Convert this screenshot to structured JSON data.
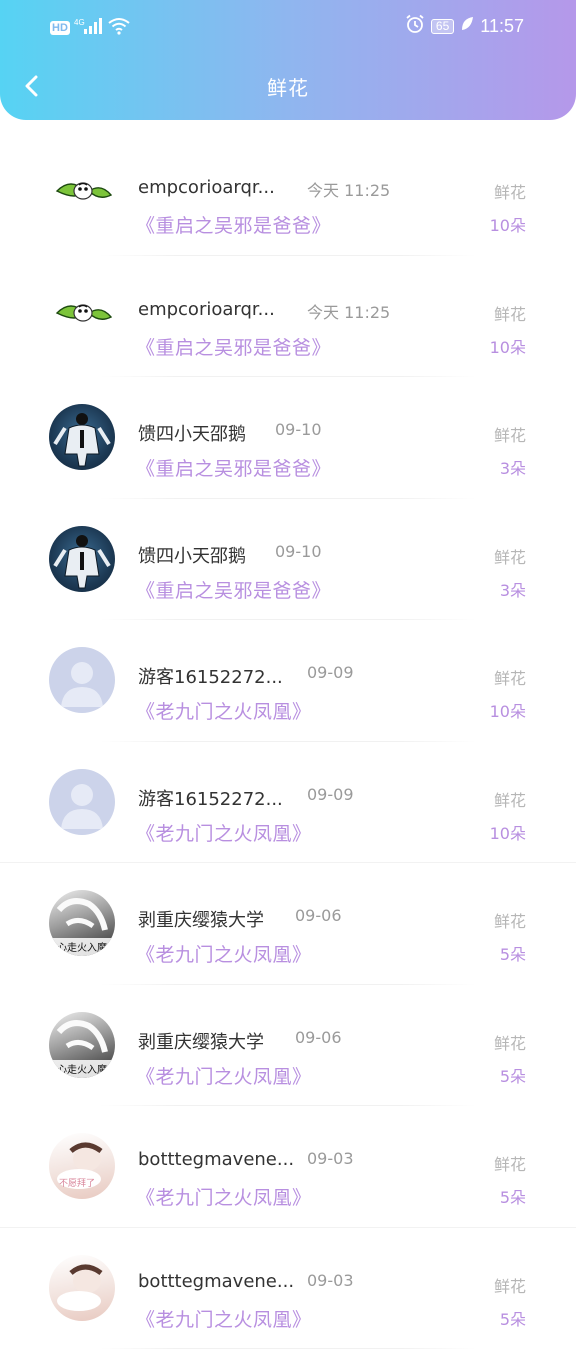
{
  "status_bar": {
    "hd": "HD",
    "network": "4G",
    "battery": "65",
    "time": "11:57"
  },
  "header": {
    "title": "鲜花"
  },
  "records": [
    {
      "avatar": "bird-avatar",
      "name": "empcorioarqr...",
      "time": "今天 11:25",
      "book": "《重启之吴邪是爸爸》",
      "gift": "鲜花",
      "count": "10朵"
    },
    {
      "avatar": "bird-avatar",
      "name": "empcorioarqr...",
      "time": "今天 11:25",
      "book": "《重启之吴邪是爸爸》",
      "gift": "鲜花",
      "count": "10朵"
    },
    {
      "avatar": "figure-avatar",
      "name": "馈四小天邵鹅",
      "time": "09-10",
      "book": "《重启之吴邪是爸爸》",
      "gift": "鲜花",
      "count": "3朵"
    },
    {
      "avatar": "figure-avatar",
      "name": "馈四小天邵鹅",
      "time": "09-10",
      "book": "《重启之吴邪是爸爸》",
      "gift": "鲜花",
      "count": "3朵"
    },
    {
      "avatar": "default-avatar",
      "name": "游客16152272...",
      "time": "09-09",
      "book": "《老九门之火凤凰》",
      "gift": "鲜花",
      "count": "10朵"
    },
    {
      "avatar": "default-avatar",
      "name": "游客16152272...",
      "time": "09-09",
      "book": "《老九门之火凤凰》",
      "gift": "鲜花",
      "count": "10朵"
    },
    {
      "avatar": "bw-photo-avatar",
      "name": "剥重庆缨猿大学",
      "time": "09-06",
      "book": "《老九门之火凤凰》",
      "gift": "鲜花",
      "count": "5朵",
      "avatar_text": "心走火入魔"
    },
    {
      "avatar": "bw-photo-avatar",
      "name": "剥重庆缨猿大学",
      "time": "09-06",
      "book": "《老九门之火凤凰》",
      "gift": "鲜花",
      "count": "5朵",
      "avatar_text": "心走火入魔"
    },
    {
      "avatar": "photo-avatar",
      "name": "botttegmavene...",
      "time": "09-03",
      "book": "《老九门之火凤凰》",
      "gift": "鲜花",
      "count": "5朵",
      "avatar_text": "不愿拜了"
    },
    {
      "avatar": "photo-avatar",
      "name": "botttegmavene...",
      "time": "09-03",
      "book": "《老九门之火凤凰》",
      "gift": "鲜花",
      "count": "5朵"
    }
  ],
  "colors": {
    "header_gradient": [
      "#56d3f3",
      "#b598ea"
    ],
    "accent_purple": "#b88fe0",
    "muted_gray": "#9a9a9a"
  }
}
